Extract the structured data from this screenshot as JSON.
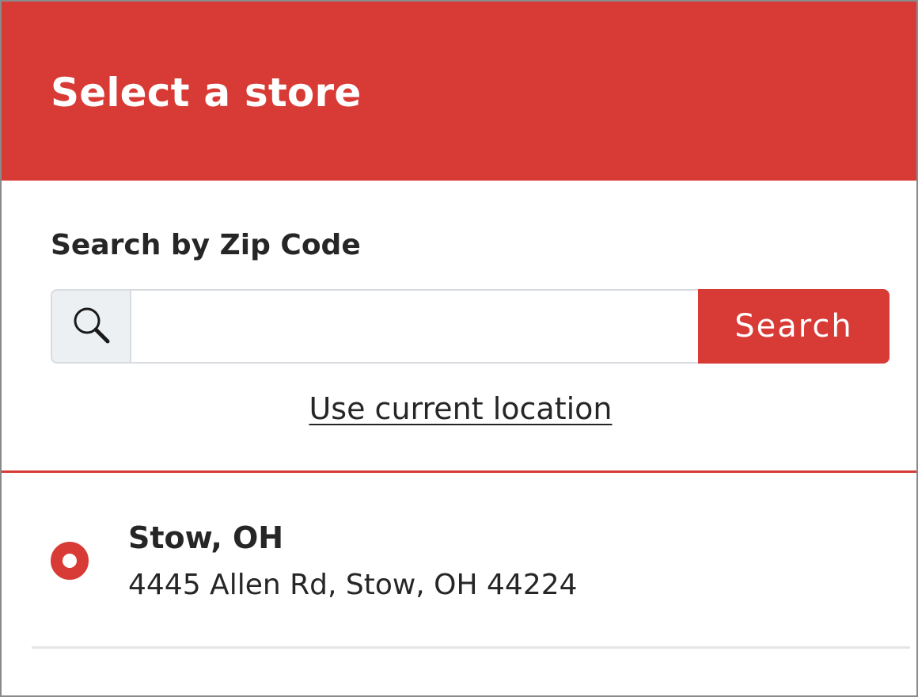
{
  "header": {
    "title": "Select a store"
  },
  "search": {
    "label": "Search by Zip Code",
    "input_value": "",
    "input_placeholder": "",
    "button_label": "Search",
    "icon": "search-icon"
  },
  "location": {
    "link_label": "Use current location"
  },
  "stores": [
    {
      "name": "Stow, OH",
      "address": "4445 Allen Rd, Stow, OH 44224",
      "selected": true
    }
  ],
  "colors": {
    "accent": "#d83b36",
    "text": "#262626",
    "input_border": "#d8dce0",
    "icon_box_bg": "#edf0f3",
    "divider_grey": "#e3e5e7"
  }
}
